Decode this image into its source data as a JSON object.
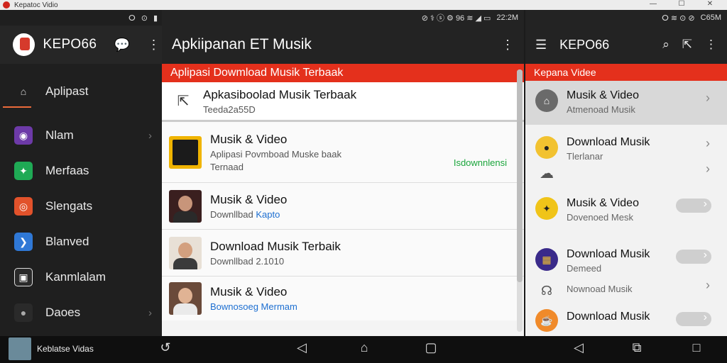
{
  "window": {
    "title": "Kepatoc Vidio",
    "controls": [
      "—",
      "☐",
      "✕"
    ]
  },
  "left_panel": {
    "status": {
      "icons": [
        "ⵔ",
        "⊙",
        "▮"
      ]
    },
    "brand": "KEPO66",
    "icons": {
      "chat": "chat-icon",
      "menu": "more-vert-icon"
    },
    "items": [
      {
        "label": "Aplipast",
        "icon": "folder-icon",
        "color": "#3a3a3a",
        "active": true,
        "chevron": false
      },
      {
        "label": "Nlam",
        "icon": "camera-icon",
        "color": "#6d3aa8",
        "active": false,
        "chevron": true
      },
      {
        "label": "Merfaas",
        "icon": "twitter-icon",
        "color": "#1faa55",
        "active": false,
        "chevron": false
      },
      {
        "label": "Slengats",
        "icon": "podcast-icon",
        "color": "#e2522b",
        "active": false,
        "chevron": false
      },
      {
        "label": "Blanved",
        "icon": "bird-icon",
        "color": "#2f78d6",
        "active": false,
        "chevron": false
      },
      {
        "label": "Kanmlalam",
        "icon": "gallery-icon",
        "color": "#2a2a2a",
        "active": false,
        "chevron": false
      },
      {
        "label": "Daoes",
        "icon": "disc-icon",
        "color": "#2a2a2a",
        "active": false,
        "chevron": true
      }
    ]
  },
  "middle_panel": {
    "status": {
      "text": "⊘ ⚕ ⓢ ⚙ 96 ≋ ◢ ▭",
      "time": "22:2M"
    },
    "title": "Apkiipanan ET Musik",
    "banner": "Aplipasi Dowmload Musik Terbaak",
    "featured": {
      "title": "Apkasiboolad Musik Terbaak",
      "sub": "Teeda2a55D"
    },
    "rows": [
      {
        "title": "Musik & Video",
        "sub": "Aplipasi Povmboad Muske baak",
        "sub2": "Ternaad",
        "badge": "Isdownnlensi",
        "thumb": "app"
      },
      {
        "title": "Musik & Video",
        "sub": "Downllbad",
        "sub_link": "Kapto",
        "thumb": "person1"
      },
      {
        "title": "Download Musik Terbaik",
        "sub": "Downllbad 2.1010",
        "thumb": "person2"
      },
      {
        "title": "Musik & Video",
        "sub_link": "Bownosoeg Mermam",
        "thumb": "person3"
      }
    ],
    "accent_green": "#1aa53b",
    "accent_blue": "#1d6fd1"
  },
  "right_panel": {
    "status": {
      "text": "ⵔ ≋ ⊙ ⊘",
      "time": "C65M"
    },
    "title": "KEPO66",
    "banner": "Kepana Videe",
    "items": [
      {
        "title": "Musik & Video",
        "sub": "Atmenoad Musik",
        "icon": "home-icon",
        "icon_bg": "#6a6a6a",
        "control": "chevron",
        "selected": true
      },
      {
        "title": "Download Musik",
        "sub": "Tlerlanar",
        "icon": "user-icon",
        "icon_bg": "#f2c230",
        "control": "chevron",
        "selected": false
      },
      {
        "title": "",
        "sub": "",
        "icon": "cloud-icon",
        "icon_bg": "transparent",
        "control": "chevron",
        "selected": false
      },
      {
        "title": "Musik & Video",
        "sub": "Dovenoed Mesk",
        "icon": "twitter-icon",
        "icon_bg": "#f0c419",
        "control": "toggle",
        "selected": false
      },
      {
        "title": "Download Musik",
        "sub": "Demeed",
        "icon": "grid-icon",
        "icon_bg": "#3a2a8a",
        "control": "toggle",
        "selected": false
      },
      {
        "title": "",
        "sub": "Nownoad Musik",
        "icon": "headphones-icon",
        "icon_bg": "transparent",
        "control": "chevron",
        "selected": false
      },
      {
        "title": "Download Musik",
        "sub": "",
        "icon": "coffee-icon",
        "icon_bg": "#f08a2a",
        "control": "toggle",
        "selected": false
      }
    ]
  },
  "bottom_nav": {
    "caption": "Keblatse Vidas",
    "buttons": [
      "back-icon",
      "back-triangle-icon",
      "home-icon",
      "recents-icon",
      "back-triangle-icon",
      "recents-icon",
      "square-icon"
    ]
  }
}
